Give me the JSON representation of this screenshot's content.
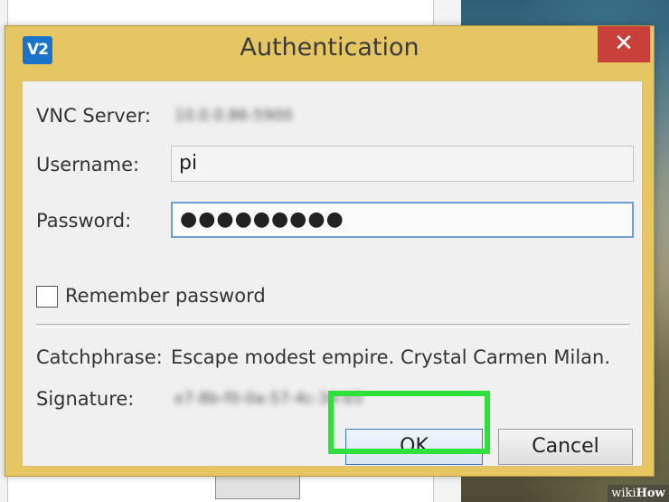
{
  "dialog": {
    "app_icon_text": "V2",
    "title": "Authentication",
    "close_glyph": "✕"
  },
  "fields": {
    "vnc_server": {
      "label": "VNC Server:",
      "value": "10.0.0.86-5900"
    },
    "username": {
      "label": "Username:",
      "value": "pi"
    },
    "password": {
      "label": "Password:",
      "value": "●●●●●●●●●"
    }
  },
  "remember": {
    "label": "Remember password",
    "checked": false
  },
  "catchphrase": {
    "label": "Catchphrase:",
    "value": "Escape modest empire. Crystal Carmen Milan."
  },
  "signature": {
    "label": "Signature:",
    "value": "e7-8b-f0-0a-57-4c-34-b5"
  },
  "buttons": {
    "ok": "OK",
    "cancel": "Cancel"
  },
  "watermark": {
    "part1": "wiki",
    "part2": "How"
  },
  "colors": {
    "dialog_frame": "#e5c662",
    "close_button": "#c9403a",
    "app_icon": "#1a73c8",
    "highlight": "#2fe03c",
    "focus_border": "#6a9fd8"
  },
  "icons": {
    "app": "vnc-viewer-icon",
    "close": "close-icon",
    "checkbox": "checkbox-unchecked"
  }
}
